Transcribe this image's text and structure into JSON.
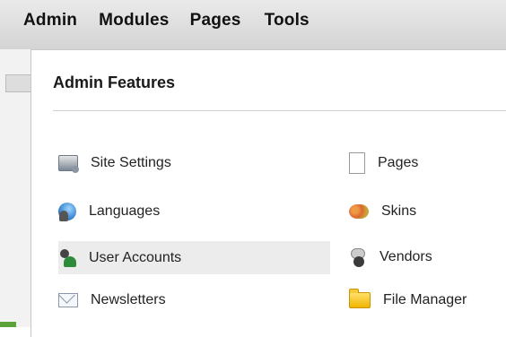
{
  "menu": {
    "items": [
      {
        "label": "Admin"
      },
      {
        "label": "Modules"
      },
      {
        "label": "Pages"
      },
      {
        "label": "Tools"
      }
    ]
  },
  "panel": {
    "title": "Admin Features",
    "features_left": [
      {
        "label": "Site Settings",
        "icon": "settings-icon"
      },
      {
        "label": "Languages",
        "icon": "globe-icon"
      },
      {
        "label": "User Accounts",
        "icon": "users-icon",
        "highlighted": true
      },
      {
        "label": "Newsletters",
        "icon": "mail-icon"
      }
    ],
    "features_right": [
      {
        "label": "Pages",
        "icon": "page-icon"
      },
      {
        "label": "Skins",
        "icon": "palette-icon"
      },
      {
        "label": "Vendors",
        "icon": "vendors-icon"
      },
      {
        "label": "File Manager",
        "icon": "folder-icon"
      }
    ]
  },
  "colors": {
    "highlight": "#ececec",
    "menubar": "#d4d4d4"
  }
}
